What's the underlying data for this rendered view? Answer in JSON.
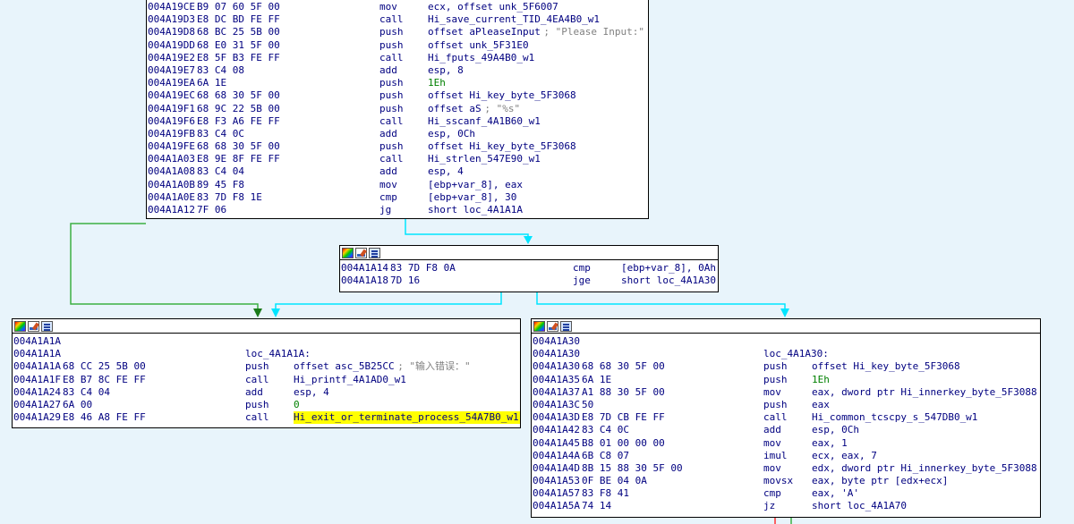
{
  "colors": {
    "background": "#e8f4fb",
    "edge_true": "#3cb043",
    "edge_false": "#00e5ff",
    "highlight": "#ffff00",
    "red_edge": "#ff3030"
  },
  "nodes": {
    "top": {
      "rows": [
        {
          "addr": "004A19CE",
          "bytes": "B9 07 60 5F 00",
          "mn": "mov",
          "op": "ecx, offset unk_5F6007",
          "cm": ""
        },
        {
          "addr": "004A19D3",
          "bytes": "E8 DC BD FE FF",
          "mn": "call",
          "op": "Hi_save_current_TID_4EA4B0_w1",
          "cm": ""
        },
        {
          "addr": "004A19D8",
          "bytes": "68 BC 25 5B 00",
          "mn": "push",
          "op": "offset aPleaseInput",
          "cm": "; \"Please Input:\""
        },
        {
          "addr": "004A19DD",
          "bytes": "68 E0 31 5F 00",
          "mn": "push",
          "op": "offset unk_5F31E0",
          "cm": ""
        },
        {
          "addr": "004A19E2",
          "bytes": "E8 5F B3 FE FF",
          "mn": "call",
          "op": "Hi_fputs_49A4B0_w1",
          "cm": ""
        },
        {
          "addr": "004A19E7",
          "bytes": "83 C4 08",
          "mn": "add",
          "op": "esp, 8",
          "cm": ""
        },
        {
          "addr": "004A19EA",
          "bytes": "6A 1E",
          "mn": "push",
          "op": "1Eh",
          "cm": ""
        },
        {
          "addr": "004A19EC",
          "bytes": "68 68 30 5F 00",
          "mn": "push",
          "op": "offset Hi_key_byte_5F3068",
          "cm": ""
        },
        {
          "addr": "004A19F1",
          "bytes": "68 9C 22 5B 00",
          "mn": "push",
          "op": "offset aS",
          "cm": "; \"%s\""
        },
        {
          "addr": "004A19F6",
          "bytes": "E8 F3 A6 FE FF",
          "mn": "call",
          "op": "Hi_sscanf_4A1B60_w1",
          "cm": ""
        },
        {
          "addr": "004A19FB",
          "bytes": "83 C4 0C",
          "mn": "add",
          "op": "esp, 0Ch",
          "cm": ""
        },
        {
          "addr": "004A19FE",
          "bytes": "68 68 30 5F 00",
          "mn": "push",
          "op": "offset Hi_key_byte_5F3068",
          "cm": ""
        },
        {
          "addr": "004A1A03",
          "bytes": "E8 9E 8F FE FF",
          "mn": "call",
          "op": "Hi_strlen_547E90_w1",
          "cm": ""
        },
        {
          "addr": "004A1A08",
          "bytes": "83 C4 04",
          "mn": "add",
          "op": "esp, 4",
          "cm": ""
        },
        {
          "addr": "004A1A0B",
          "bytes": "89 45 F8",
          "mn": "mov",
          "op": "[ebp+var_8], eax",
          "cm": ""
        },
        {
          "addr": "004A1A0E",
          "bytes": "83 7D F8 1E",
          "mn": "cmp",
          "op": "[ebp+var_8], 30",
          "cm": ""
        },
        {
          "addr": "004A1A12",
          "bytes": "7F 06",
          "mn": "jg",
          "op": "short loc_4A1A1A",
          "cm": ""
        }
      ]
    },
    "middle": {
      "rows": [
        {
          "addr": "004A1A14",
          "bytes": "83 7D F8 0A",
          "mn": "cmp",
          "op": "[ebp+var_8], 0Ah",
          "cm": ""
        },
        {
          "addr": "004A1A18",
          "bytes": "7D 16",
          "mn": "jge",
          "op": "short loc_4A1A30",
          "cm": ""
        }
      ]
    },
    "left": {
      "rows": [
        {
          "addr": "004A1A1A",
          "bytes": "",
          "mn": "",
          "op": "",
          "cm": ""
        },
        {
          "addr": "004A1A1A",
          "bytes": "",
          "mn": "loc_4A1A1A:",
          "op": "",
          "cm": ""
        },
        {
          "addr": "004A1A1A",
          "bytes": "68 CC 25 5B 00",
          "mn": "push",
          "op": "offset asc_5B25CC",
          "cm": "; \"输入错误：\""
        },
        {
          "addr": "004A1A1F",
          "bytes": "E8 B7 8C FE FF",
          "mn": "call",
          "op": "Hi_printf_4A1AD0_w1",
          "cm": ""
        },
        {
          "addr": "004A1A24",
          "bytes": "83 C4 04",
          "mn": "add",
          "op": "esp, 4",
          "cm": ""
        },
        {
          "addr": "004A1A27",
          "bytes": "6A 00",
          "mn": "push",
          "op": "0",
          "cm": ""
        },
        {
          "addr": "004A1A29",
          "bytes": "E8 46 A8 FE FF",
          "mn": "call",
          "op": "Hi_exit_or_terminate_process_54A7B0_w1",
          "cm": ""
        }
      ]
    },
    "right": {
      "rows": [
        {
          "addr": "004A1A30",
          "bytes": "",
          "mn": "",
          "op": "",
          "cm": ""
        },
        {
          "addr": "004A1A30",
          "bytes": "",
          "mn": "loc_4A1A30:",
          "op": "",
          "cm": ""
        },
        {
          "addr": "004A1A30",
          "bytes": "68 68 30 5F 00",
          "mn": "push",
          "op": "offset Hi_key_byte_5F3068",
          "cm": ""
        },
        {
          "addr": "004A1A35",
          "bytes": "6A 1E",
          "mn": "push",
          "op": "1Eh",
          "cm": ""
        },
        {
          "addr": "004A1A37",
          "bytes": "A1 88 30 5F 00",
          "mn": "mov",
          "op": "eax, dword ptr Hi_innerkey_byte_5F3088",
          "cm": ""
        },
        {
          "addr": "004A1A3C",
          "bytes": "50",
          "mn": "push",
          "op": "eax",
          "cm": ""
        },
        {
          "addr": "004A1A3D",
          "bytes": "E8 7D CB FE FF",
          "mn": "call",
          "op": "Hi_common_tcscpy_s_547DB0_w1",
          "cm": ""
        },
        {
          "addr": "004A1A42",
          "bytes": "83 C4 0C",
          "mn": "add",
          "op": "esp, 0Ch",
          "cm": ""
        },
        {
          "addr": "004A1A45",
          "bytes": "B8 01 00 00 00",
          "mn": "mov",
          "op": "eax, 1",
          "cm": ""
        },
        {
          "addr": "004A1A4A",
          "bytes": "6B C8 07",
          "mn": "imul",
          "op": "ecx, eax, 7",
          "cm": ""
        },
        {
          "addr": "004A1A4D",
          "bytes": "8B 15 88 30 5F 00",
          "mn": "mov",
          "op": "edx, dword ptr Hi_innerkey_byte_5F3088",
          "cm": ""
        },
        {
          "addr": "004A1A53",
          "bytes": "0F BE 04 0A",
          "mn": "movsx",
          "op": "eax, byte ptr [edx+ecx]",
          "cm": ""
        },
        {
          "addr": "004A1A57",
          "bytes": "83 F8 41",
          "mn": "cmp",
          "op": "eax, 'A'",
          "cm": ""
        },
        {
          "addr": "004A1A5A",
          "bytes": "74 14",
          "mn": "jz",
          "op": "short loc_4A1A70",
          "cm": ""
        }
      ]
    }
  }
}
